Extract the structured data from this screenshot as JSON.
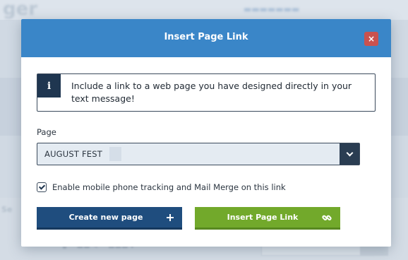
{
  "modal": {
    "title": "Insert Page Link",
    "close_glyph": "×",
    "info": {
      "icon_glyph": "i",
      "text": "Include a link to a web page you have designed directly in your text message!"
    },
    "page_field": {
      "label": "Page",
      "selected_value": "AUGUST FEST"
    },
    "tracking_checkbox": {
      "label": "Enable mobile phone tracking and Mail Merge on this link",
      "checked": true
    },
    "buttons": {
      "create_label": "Create new page",
      "insert_label": "Insert Page Link"
    }
  },
  "icons": {
    "close": "close-icon",
    "info": "info-icon",
    "dropdown": "chevron-down-icon",
    "checkbox": "checkmark-icon",
    "create": "plus-icon",
    "insert": "link-icon"
  },
  "colors": {
    "header": "#3a86c8",
    "close_button": "#c9524f",
    "info_icon_bg": "#1f3650",
    "create_button": "#1f4d7e",
    "insert_button": "#72a92b"
  }
}
